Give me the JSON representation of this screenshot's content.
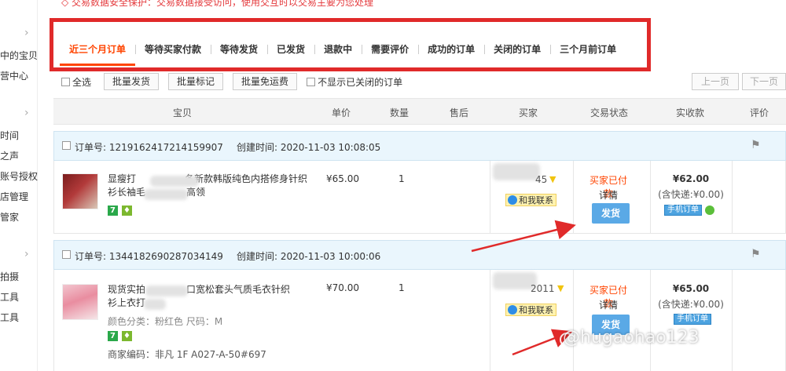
{
  "left_nav": {
    "items": [
      "中的宝贝",
      "营中心",
      "时间",
      "之声",
      "账号授权",
      "店管理",
      "管家",
      "拍摄",
      "工具",
      "工具"
    ]
  },
  "notice": "◇ 交易数据安全保护：交易数据接受访问，使用交互时以交易主要为您处理",
  "tabs": [
    "近三个月订单",
    "等待买家付款",
    "等待发货",
    "已发货",
    "退款中",
    "需要评价",
    "成功的订单",
    "关闭的订单",
    "三个月前订单"
  ],
  "toolbar": {
    "select_all": "全选",
    "batch_ship": "批量发货",
    "batch_mark": "批量标记",
    "batch_free_ship": "批量免运费",
    "hide_closed": "不显示已关闭的订单",
    "prev_page": "上一页",
    "next_page": "下一页"
  },
  "columns": [
    "宝贝",
    "单价",
    "数量",
    "售后",
    "买家",
    "交易状态",
    "实收款",
    "评价"
  ],
  "orders": [
    {
      "order_no_label": "订单号: 1219162417214159907",
      "created_label": "创建时间: 2020-11-03 10:08:05",
      "title_line1": "显瘦打",
      "title_line1_b": "冬新款韩版纯色内搭修身针织",
      "title_line2": "衫长袖毛",
      "title_line2_b": "高领",
      "price": "¥65.00",
      "qty": "1",
      "buyer_tail": "45",
      "contact": "和我联系",
      "status": "买家已付款",
      "detail": "详情",
      "ship_button": "发货",
      "total": "¥62.00",
      "shipping_fee": "(含快递:¥0.00)",
      "mobile_tag": "手机订单"
    },
    {
      "order_no_label": "订单号: 1344182690287034149",
      "created_label": "创建时间: 2020-11-03 10:00:06",
      "title_line1": "现货实拍",
      "title_line1_b": "口宽松套头气质毛衣针织",
      "title_line2": "衫上衣打",
      "title_line2_b": "",
      "sku": "颜色分类：粉红色   尺码：M",
      "merchant_code": "商家编码：非凡 1F A027-A-50#697",
      "price": "¥70.00",
      "qty": "1",
      "buyer_tail": "2011",
      "contact": "和我联系",
      "status": "买家已付款",
      "detail": "详情",
      "ship_button": "发货",
      "total": "¥65.00",
      "shipping_fee": "(含快递:¥0.00)",
      "mobile_tag": "手机订单"
    }
  ],
  "watermark": "@hugaohao123",
  "colors": {
    "accent": "#ff4400",
    "annotation_red": "#e02a2a",
    "order_header_bg": "#eaf6fd",
    "ship_button": "#5aa9e6"
  }
}
